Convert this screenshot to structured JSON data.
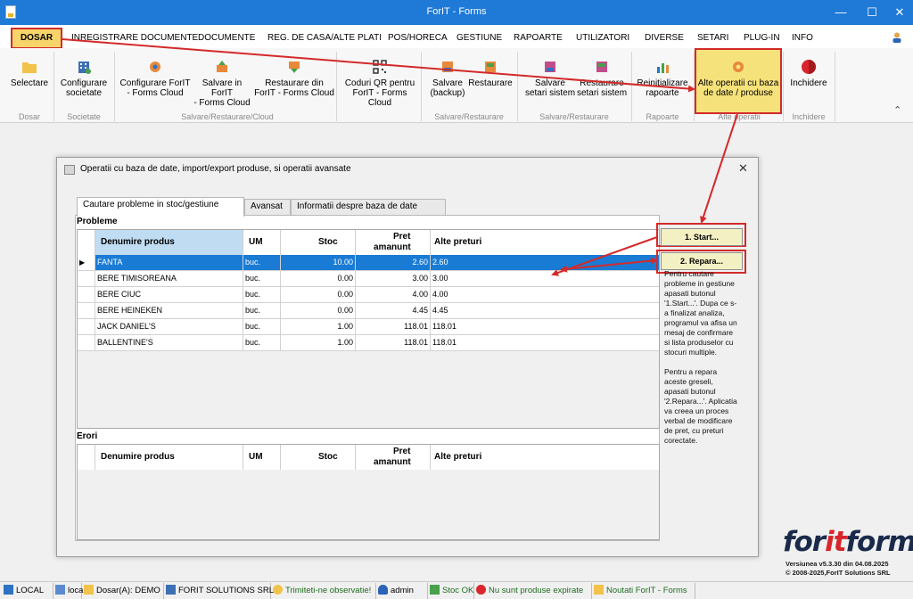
{
  "window": {
    "title": "ForIT - Forms"
  },
  "menu": [
    "DOSAR",
    "INREGISTRARE DOCUMENTE",
    "DOCUMENTE",
    "REG. DE CASA/ALTE PLATI",
    "POS/HORECA",
    "GESTIUNE",
    "RAPOARTE",
    "UTILIZATORI",
    "DIVERSE",
    "SETARI",
    "PLUG-IN",
    "INFO"
  ],
  "ribbon": {
    "buttons": [
      {
        "line1": "Selectare",
        "line2": ""
      },
      {
        "line1": "Configurare",
        "line2": "societate"
      },
      {
        "line1": "Configurare ForIT",
        "line2": "- Forms Cloud"
      },
      {
        "line1": "Salvare in ForIT",
        "line2": "- Forms Cloud"
      },
      {
        "line1": "Restaurare din",
        "line2": "ForIT - Forms Cloud"
      },
      {
        "line1": "Coduri QR pentru",
        "line2": "ForIT - Forms Cloud"
      },
      {
        "line1": "Salvare",
        "line2": "(backup)"
      },
      {
        "line1": "Restaurare",
        "line2": ""
      },
      {
        "line1": "Salvare",
        "line2": "setari sistem"
      },
      {
        "line1": "Restaurare",
        "line2": "setari sistem"
      },
      {
        "line1": "Reinitializare",
        "line2": "rapoarte"
      },
      {
        "line1": "Alte operatii cu baza",
        "line2": "de date / produse"
      },
      {
        "line1": "Inchidere",
        "line2": ""
      }
    ],
    "groups": [
      "Dosar",
      "Societate",
      "Salvare/Restaurare/Cloud",
      "Salvare/Restaurare",
      "Salvare/Restaurare",
      "Rapoarte",
      "Alte operatii",
      "Inchidere"
    ]
  },
  "dialog": {
    "title": "Operatii cu baza de date, import/export produse, si operatii avansate",
    "tabs": [
      "Cautare probleme in stoc/gestiune",
      "Avansat",
      "Informatii despre baza de date"
    ],
    "probleme_label": "Probleme",
    "erori_label": "Erori",
    "columns": [
      "Denumire produs",
      "UM",
      "Stoc",
      "Pret",
      "amanunt",
      "Alte preturi"
    ],
    "rows": [
      {
        "name": "FANTA",
        "um": "buc.",
        "stoc": "10.00",
        "pret": "2.60",
        "alte": "2.60"
      },
      {
        "name": "BERE TIMISOREANA",
        "um": "buc.",
        "stoc": "0.00",
        "pret": "3.00",
        "alte": "3.00"
      },
      {
        "name": "BERE CIUC",
        "um": "buc.",
        "stoc": "0.00",
        "pret": "4.00",
        "alte": "4.00"
      },
      {
        "name": "BERE HEINEKEN",
        "um": "buc.",
        "stoc": "0.00",
        "pret": "4.45",
        "alte": "4.45"
      },
      {
        "name": "JACK DANIEL'S",
        "um": "buc.",
        "stoc": "1.00",
        "pret": "118.01",
        "alte": "118.01"
      },
      {
        "name": "BALLENTINE'S",
        "um": "buc.",
        "stoc": "1.00",
        "pret": "118.01",
        "alte": "118.01"
      }
    ],
    "start_button": "1. Start...",
    "repara_button": "2. Repara...",
    "help_p1": "Pentru cautare probleme in gestiune apasati butonul '1.Start...'. Dupa ce s-a finalizat analiza, programul va afisa un mesaj de confirmare si lista produselor cu stocuri multiple.",
    "help_p2": "Pentru a repara aceste greseli, apasati butonul '2.Repara...'. Aplicatia va creea un proces verbal de modificare de pret, cu preturi corectate."
  },
  "logo": {
    "part1": "for",
    "part2": "it",
    "part3": "forms",
    "version": "Versiunea v5.3.30 din 04.08.2025",
    "copyright": "© 2008-2025,ForIT Solutions SRL"
  },
  "statusbar": [
    "LOCAL",
    "local",
    "Dosar(A): DEMO",
    "FORIT SOLUTIONS SRL",
    "Trimiteti-ne observatie!",
    "admin",
    "Stoc OK",
    "Nu sunt produse expirate",
    "Noutati ForIT - Forms"
  ]
}
